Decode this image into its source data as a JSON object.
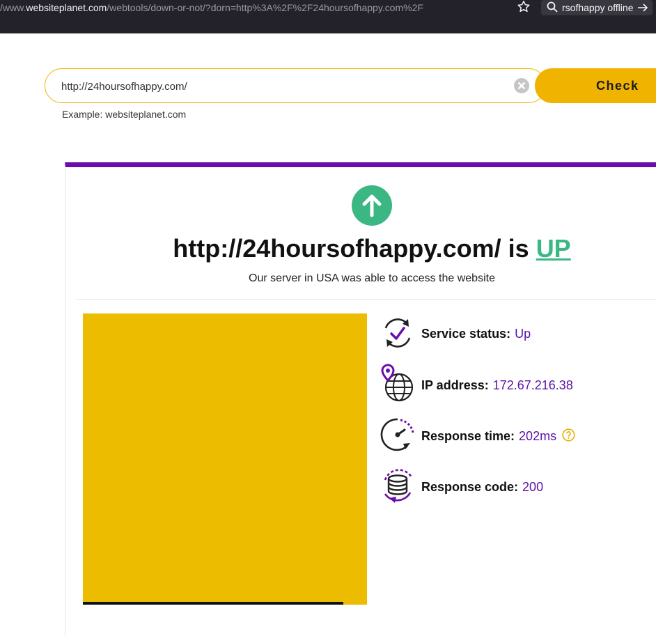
{
  "browser": {
    "url_prefix": "/www.",
    "url_host": "websiteplanet.com",
    "url_path": "/webtools/down-or-not/?dorn=http%3A%2F%2F24hoursofhappy.com%2F",
    "search_text": "rsofhappy offline"
  },
  "search": {
    "value": "http://24hoursofhappy.com/",
    "button_label": "Check",
    "example": "Example: websiteplanet.com"
  },
  "result": {
    "url": "http://24hoursofhappy.com/",
    "is_text": "is",
    "status": "UP",
    "subtitle": "Our server in USA was able to access the website"
  },
  "details": [
    {
      "label": "Service status:",
      "value": "Up",
      "icon": "service-status-icon"
    },
    {
      "label": "IP address:",
      "value": "172.67.216.38",
      "icon": "globe-pin-icon"
    },
    {
      "label": "Response time:",
      "value": "202ms",
      "icon": "stopwatch-icon"
    },
    {
      "label": "Response code:",
      "value": "200",
      "icon": "database-icon"
    }
  ],
  "colors": {
    "accent_purple": "#6a0dad",
    "accent_yellow": "#f0b400",
    "status_green": "#3bb784",
    "value_purple": "#5b12a8",
    "screenshot_fill": "#ecbc00"
  }
}
